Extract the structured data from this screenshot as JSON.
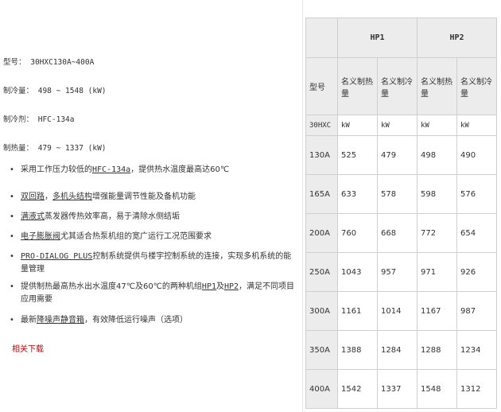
{
  "specs": {
    "model": "型号： 30HXC130A~400A",
    "cooling": "制冷量： 498 ~ 1548 (kW)",
    "refrigerant": "制冷剂： HFC-134a",
    "heating": "制热量： 479 ~ 1337 (kW)"
  },
  "features": [
    {
      "pre": "采用工作压力较低的",
      "hl": "HFC-134a",
      "post": "，提供热水温度最高达60℃"
    },
    {
      "hl1": "双回路",
      "mid": "，",
      "hl2": "多机头结构",
      "post": "增强能量调节性能及备机功能"
    },
    {
      "hl": "满液式",
      "post": "蒸发器传热效率高，易于清除水侧结垢"
    },
    {
      "hl": "电子膨胀阀",
      "post": "尤其适合热泵机组的宽广运行工况范围要求"
    },
    {
      "hl": "PRO-DIALOG PLUS",
      "post": "控制系统提供与楼宇控制系统的连接，实现多机系统的能量管理"
    },
    {
      "pre": "提供制热最高热水出水温度47℃及60℃的两种机组",
      "hl1": "HP1",
      "mid": "及",
      "hl2": "HP2",
      "post": "，满足不同项目应用需要"
    },
    {
      "pre": "最新",
      "hl": "降噪声静音箱",
      "post": "，有效降低运行噪声（选项）"
    }
  ],
  "download_link": "相关下载",
  "table": {
    "model_header": "型号",
    "groups": [
      "HP1",
      "HP2"
    ],
    "sub_headers": [
      "名义制热量",
      "名义制冷量",
      "名义制热量",
      "名义制冷量"
    ],
    "unit_row": [
      "30HXC",
      "kW",
      "kW",
      "kW",
      "kW"
    ],
    "rows": [
      [
        "130A",
        "525",
        "479",
        "498",
        "490"
      ],
      [
        "165A",
        "633",
        "578",
        "598",
        "576"
      ],
      [
        "200A",
        "760",
        "668",
        "772",
        "654"
      ],
      [
        "250A",
        "1043",
        "957",
        "971",
        "926"
      ],
      [
        "300A",
        "1161",
        "1014",
        "1167",
        "987"
      ],
      [
        "350A",
        "1388",
        "1284",
        "1288",
        "1234"
      ],
      [
        "400A",
        "1542",
        "1337",
        "1548",
        "1312"
      ]
    ]
  }
}
